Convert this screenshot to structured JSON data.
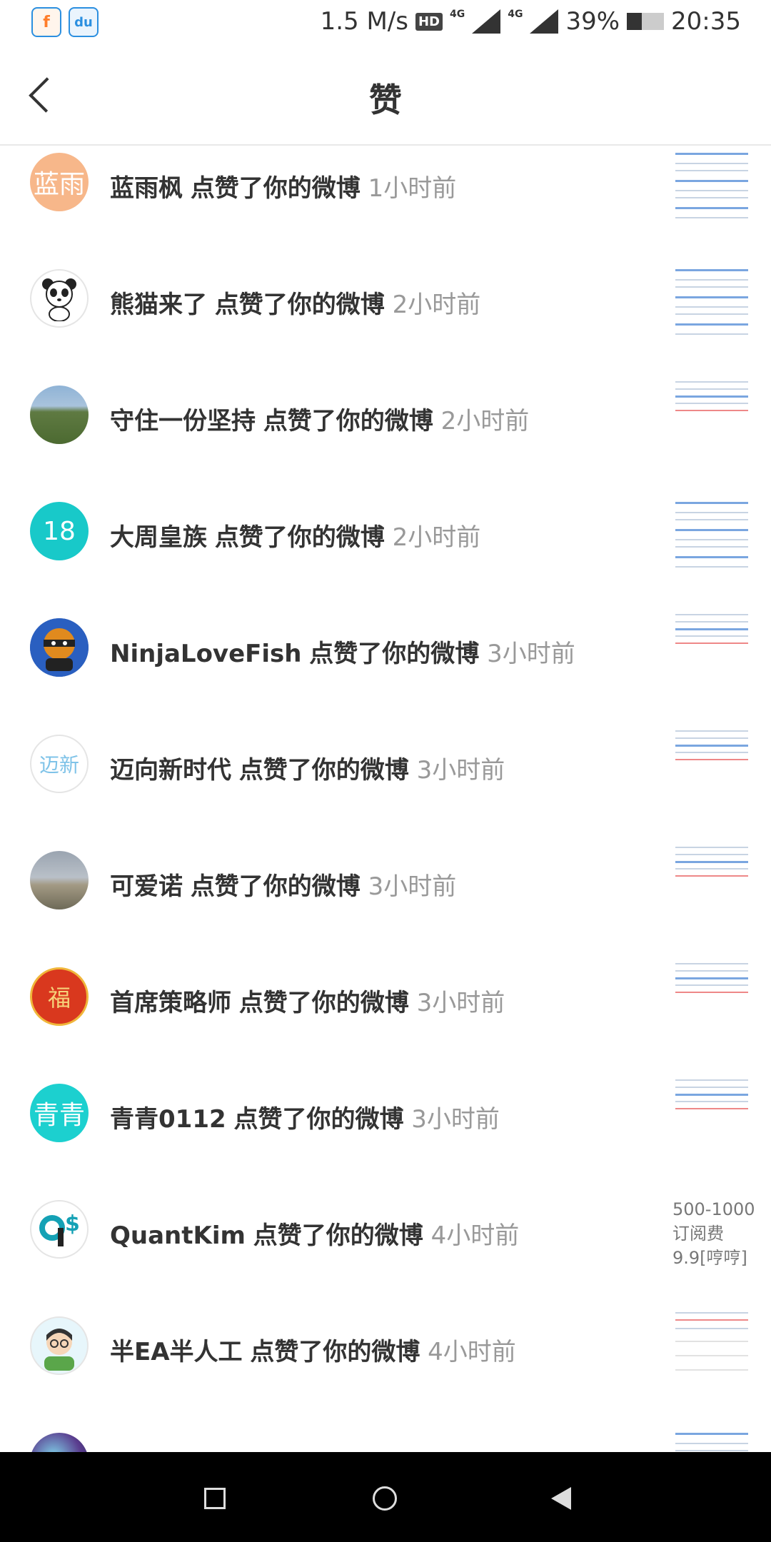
{
  "status_bar": {
    "speed": "1.5 M/s",
    "hd": "HD",
    "net1": "4G",
    "net2": "4G",
    "battery": "39%",
    "time": "20:35"
  },
  "header": {
    "title": "赞"
  },
  "items": [
    {
      "name": "蓝雨枫",
      "action": "点赞了你的微博",
      "time": "1小时前",
      "avatar_text": "蓝雨"
    },
    {
      "name": "熊猫来了",
      "action": "点赞了你的微博",
      "time": "2小时前"
    },
    {
      "name": "守住一份坚持",
      "action": "点赞了你的微博",
      "time": "2小时前"
    },
    {
      "name": "大周皇族",
      "action": "点赞了你的微博",
      "time": "2小时前",
      "avatar_text": "18"
    },
    {
      "name": "NinjaLoveFish",
      "action": "点赞了你的微博",
      "time": "3小时前"
    },
    {
      "name": "迈向新时代",
      "action": "点赞了你的微博",
      "time": "3小时前",
      "avatar_text": "迈新"
    },
    {
      "name": "可爱诺",
      "action": "点赞了你的微博",
      "time": "3小时前"
    },
    {
      "name": "首席策略师",
      "action": "点赞了你的微博",
      "time": "3小时前",
      "avatar_text": "福"
    },
    {
      "name": "青青0112",
      "action": "点赞了你的微博",
      "time": "3小时前",
      "avatar_text": "青青"
    },
    {
      "name": "QuantKim",
      "action": "点赞了你的微博",
      "time": "4小时前",
      "thumb_text": [
        "500-1000",
        "订阅费",
        "9.9[哼哼]"
      ]
    },
    {
      "name": "半EA半人工",
      "action": "点赞了你的微博",
      "time": "4小时前"
    }
  ],
  "colors": {
    "avatar_lanyu": "#f7b78a",
    "avatar_18": "#18c9c9",
    "avatar_qingqing": "#1cd0cf",
    "avatar_fu": "#d9381e"
  }
}
